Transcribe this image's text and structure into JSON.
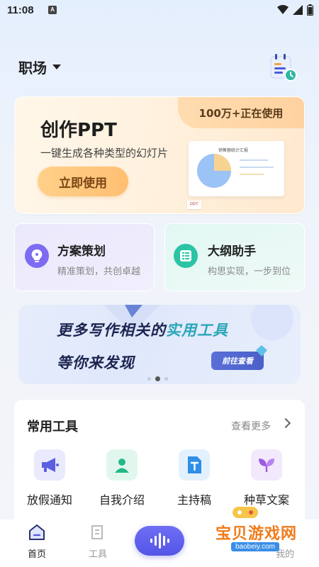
{
  "status_bar": {
    "time": "11:08",
    "a_badge": "A"
  },
  "header": {
    "title": "职场"
  },
  "ppt_card": {
    "badge": "100万+正在使用",
    "title": "创作PPT",
    "subtitle": "一键生成各种类型的幻灯片",
    "button": "立即使用",
    "illustration_title": "销售额统计汇报",
    "illustration_tag": "PPT"
  },
  "features": [
    {
      "title": "方案策划",
      "subtitle": "精准策划，共创卓越",
      "icon": "lightbulb-icon"
    },
    {
      "title": "大纲助手",
      "subtitle": "构思实现，一步到位",
      "icon": "outline-list-icon"
    }
  ],
  "banner": {
    "line1_prefix": "更多写作相关的",
    "line1_highlight": "实用工具",
    "line2": "等你来发现",
    "button": "前往查看",
    "page_count": 3,
    "active_page": 2
  },
  "tools": {
    "title": "常用工具",
    "more": "查看更多",
    "items": [
      {
        "label": "放假通知",
        "icon": "megaphone-icon"
      },
      {
        "label": "自我介绍",
        "icon": "person-icon"
      },
      {
        "label": "主持稿",
        "icon": "document-t-icon"
      },
      {
        "label": "种草文案",
        "icon": "sprout-icon"
      }
    ]
  },
  "tabbar": {
    "home": "首页",
    "tools": "工具",
    "mine": "我的"
  },
  "watermark": {
    "text": "宝贝游戏网",
    "url": "baobeiy.com"
  },
  "colors": {
    "accent": "#5455e6",
    "ppt_button": "#ffc47a",
    "feature1": "#7d6cf1",
    "feature2": "#2bc4a5",
    "banner_highlight": "#2aa6b8"
  }
}
